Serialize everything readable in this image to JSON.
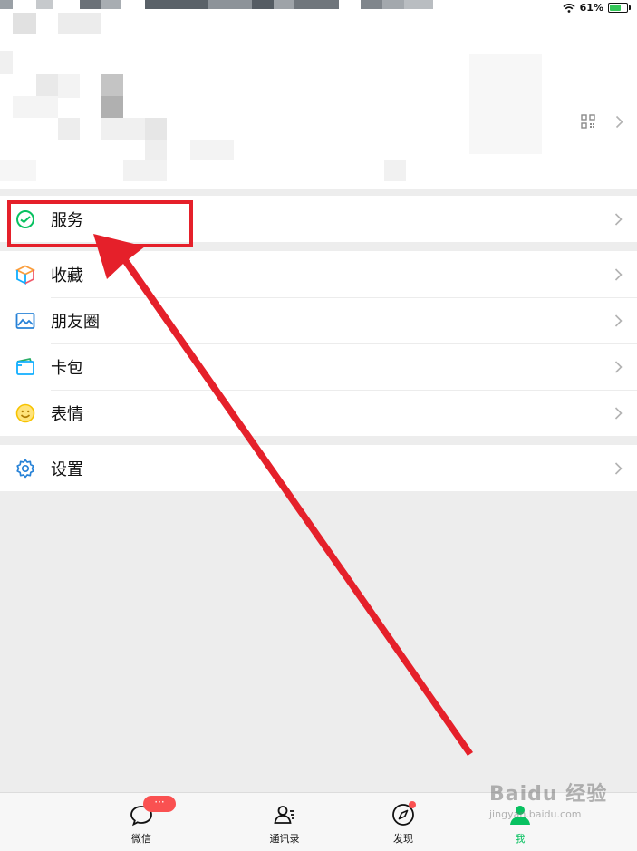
{
  "status_bar": {
    "battery": "61%"
  },
  "menu": {
    "services": "服务",
    "favorites": "收藏",
    "moments": "朋友圈",
    "cards": "卡包",
    "stickers": "表情",
    "settings": "设置"
  },
  "tabbar": {
    "chats": "微信",
    "chats_badge": "···",
    "contacts": "通讯录",
    "discover": "发现",
    "me": "我"
  },
  "watermark": {
    "logo": "Baidu 经验",
    "url": "jingyan.baidu.com"
  },
  "colors": {
    "accent_green": "#07c160",
    "highlight_red": "#e5202a",
    "badge_red": "#fa5151"
  }
}
